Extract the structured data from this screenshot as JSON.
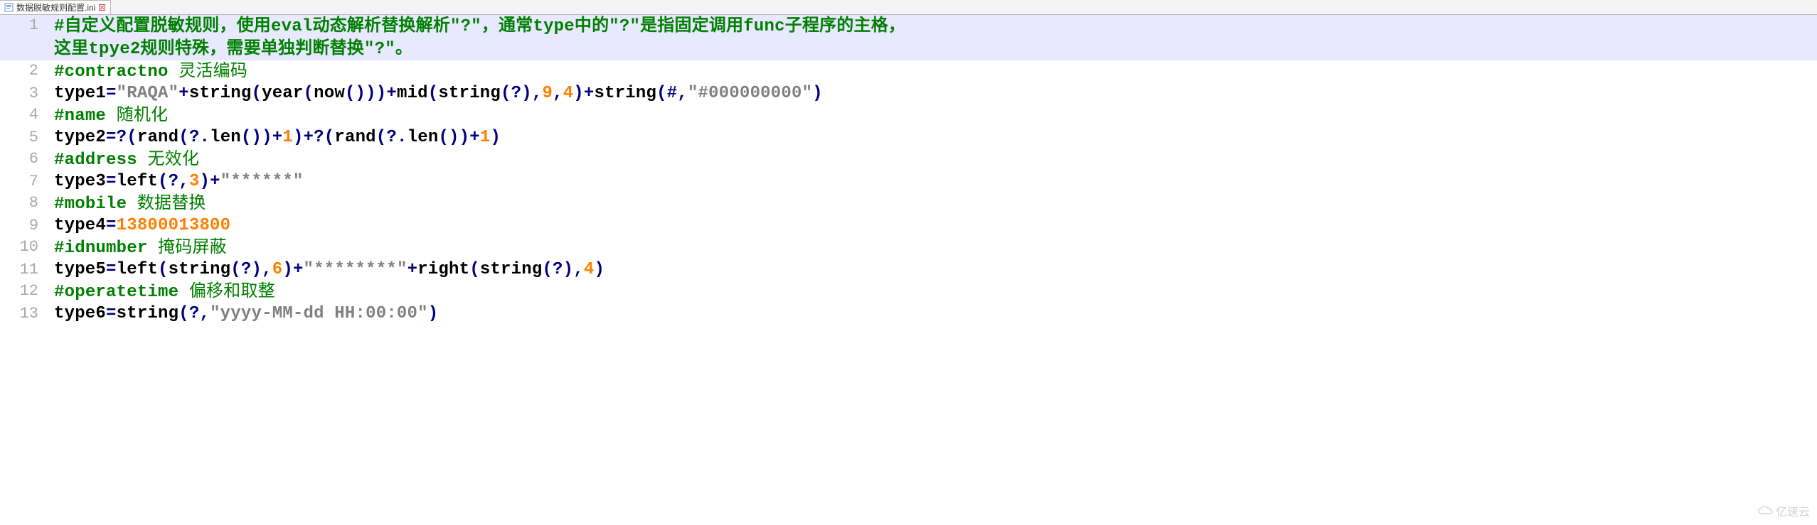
{
  "tab": {
    "filename": "数据脱敏规则配置.ini"
  },
  "watermark": "亿速云",
  "lines": [
    {
      "num": "1",
      "cursor": true,
      "tokens": [
        {
          "cls": "tok-comment-hash",
          "t": "#"
        },
        {
          "cls": "tok-comment-zh-b",
          "t": "自定义配置脱敏规则，使用"
        },
        {
          "cls": "tok-comment-en",
          "t": "eval"
        },
        {
          "cls": "tok-comment-zh-b",
          "t": "动态解析替换解析"
        },
        {
          "cls": "tok-comment-en",
          "t": "\"?\""
        },
        {
          "cls": "tok-comment-zh-b",
          "t": "，通常"
        },
        {
          "cls": "tok-comment-en",
          "t": "type"
        },
        {
          "cls": "tok-comment-zh-b",
          "t": "中的"
        },
        {
          "cls": "tok-comment-en",
          "t": "\"?\""
        },
        {
          "cls": "tok-comment-zh-b",
          "t": "是指固定调用"
        },
        {
          "cls": "tok-comment-en",
          "t": "func"
        },
        {
          "cls": "tok-comment-zh-b",
          "t": "子程序的主格，"
        }
      ]
    },
    {
      "num": "",
      "cursor": true,
      "tokens": [
        {
          "cls": "tok-comment-zh-b",
          "t": "这里"
        },
        {
          "cls": "tok-comment-en",
          "t": "tpye2"
        },
        {
          "cls": "tok-comment-zh-b",
          "t": "规则特殊，需要单独判断替换"
        },
        {
          "cls": "tok-comment-en",
          "t": "\"?\""
        },
        {
          "cls": "tok-comment-zh-b",
          "t": "。"
        }
      ]
    },
    {
      "num": "2",
      "tokens": [
        {
          "cls": "tok-comment-hash",
          "t": "#"
        },
        {
          "cls": "tok-comment-en",
          "t": "contractno "
        },
        {
          "cls": "tok-comment-zh",
          "t": "灵活编码"
        }
      ]
    },
    {
      "num": "3",
      "tokens": [
        {
          "cls": "tok-kw",
          "t": "type1"
        },
        {
          "cls": "tok-op",
          "t": "="
        },
        {
          "cls": "tok-str",
          "t": "\"RAQA\""
        },
        {
          "cls": "tok-op",
          "t": "+"
        },
        {
          "cls": "tok-func",
          "t": "string"
        },
        {
          "cls": "tok-punct",
          "t": "("
        },
        {
          "cls": "tok-func",
          "t": "year"
        },
        {
          "cls": "tok-punct",
          "t": "("
        },
        {
          "cls": "tok-func",
          "t": "now"
        },
        {
          "cls": "tok-punct",
          "t": "()))"
        },
        {
          "cls": "tok-op",
          "t": "+"
        },
        {
          "cls": "tok-func",
          "t": "mid"
        },
        {
          "cls": "tok-punct",
          "t": "("
        },
        {
          "cls": "tok-func",
          "t": "string"
        },
        {
          "cls": "tok-punct",
          "t": "("
        },
        {
          "cls": "tok-op",
          "t": "?"
        },
        {
          "cls": "tok-punct",
          "t": "),"
        },
        {
          "cls": "tok-num",
          "t": "9"
        },
        {
          "cls": "tok-punct",
          "t": ","
        },
        {
          "cls": "tok-num",
          "t": "4"
        },
        {
          "cls": "tok-punct",
          "t": ")"
        },
        {
          "cls": "tok-op",
          "t": "+"
        },
        {
          "cls": "tok-func",
          "t": "string"
        },
        {
          "cls": "tok-punct",
          "t": "("
        },
        {
          "cls": "tok-op",
          "t": "#"
        },
        {
          "cls": "tok-punct",
          "t": ","
        },
        {
          "cls": "tok-str",
          "t": "\"#000000000\""
        },
        {
          "cls": "tok-punct",
          "t": ")"
        }
      ]
    },
    {
      "num": "4",
      "tokens": [
        {
          "cls": "tok-comment-hash",
          "t": "#"
        },
        {
          "cls": "tok-comment-en",
          "t": "name "
        },
        {
          "cls": "tok-comment-zh",
          "t": "随机化"
        }
      ]
    },
    {
      "num": "5",
      "tokens": [
        {
          "cls": "tok-kw",
          "t": "type2"
        },
        {
          "cls": "tok-op",
          "t": "=?"
        },
        {
          "cls": "tok-punct",
          "t": "("
        },
        {
          "cls": "tok-func",
          "t": "rand"
        },
        {
          "cls": "tok-punct",
          "t": "("
        },
        {
          "cls": "tok-op",
          "t": "?."
        },
        {
          "cls": "tok-func",
          "t": "len"
        },
        {
          "cls": "tok-punct",
          "t": "())"
        },
        {
          "cls": "tok-op",
          "t": "+"
        },
        {
          "cls": "tok-num",
          "t": "1"
        },
        {
          "cls": "tok-punct",
          "t": ")"
        },
        {
          "cls": "tok-op",
          "t": "+?"
        },
        {
          "cls": "tok-punct",
          "t": "("
        },
        {
          "cls": "tok-func",
          "t": "rand"
        },
        {
          "cls": "tok-punct",
          "t": "("
        },
        {
          "cls": "tok-op",
          "t": "?."
        },
        {
          "cls": "tok-func",
          "t": "len"
        },
        {
          "cls": "tok-punct",
          "t": "())"
        },
        {
          "cls": "tok-op",
          "t": "+"
        },
        {
          "cls": "tok-num",
          "t": "1"
        },
        {
          "cls": "tok-punct",
          "t": ")"
        }
      ]
    },
    {
      "num": "6",
      "tokens": [
        {
          "cls": "tok-comment-hash",
          "t": "#"
        },
        {
          "cls": "tok-comment-en",
          "t": "address "
        },
        {
          "cls": "tok-comment-zh",
          "t": "无效化"
        }
      ]
    },
    {
      "num": "7",
      "tokens": [
        {
          "cls": "tok-kw",
          "t": "type3"
        },
        {
          "cls": "tok-op",
          "t": "="
        },
        {
          "cls": "tok-func",
          "t": "left"
        },
        {
          "cls": "tok-punct",
          "t": "("
        },
        {
          "cls": "tok-op",
          "t": "?"
        },
        {
          "cls": "tok-punct",
          "t": ","
        },
        {
          "cls": "tok-num",
          "t": "3"
        },
        {
          "cls": "tok-punct",
          "t": ")"
        },
        {
          "cls": "tok-op",
          "t": "+"
        },
        {
          "cls": "tok-str",
          "t": "\"******\""
        }
      ]
    },
    {
      "num": "8",
      "tokens": [
        {
          "cls": "tok-comment-hash",
          "t": "#"
        },
        {
          "cls": "tok-comment-en",
          "t": "mobile "
        },
        {
          "cls": "tok-comment-zh",
          "t": "数据替换"
        }
      ]
    },
    {
      "num": "9",
      "tokens": [
        {
          "cls": "tok-kw",
          "t": "type4"
        },
        {
          "cls": "tok-op",
          "t": "="
        },
        {
          "cls": "tok-num",
          "t": "13800013800"
        }
      ]
    },
    {
      "num": "10",
      "tokens": [
        {
          "cls": "tok-comment-hash",
          "t": "#"
        },
        {
          "cls": "tok-comment-en",
          "t": "idnumber "
        },
        {
          "cls": "tok-comment-zh",
          "t": "掩码屏蔽"
        }
      ]
    },
    {
      "num": "11",
      "tokens": [
        {
          "cls": "tok-kw",
          "t": "type5"
        },
        {
          "cls": "tok-op",
          "t": "="
        },
        {
          "cls": "tok-func",
          "t": "left"
        },
        {
          "cls": "tok-punct",
          "t": "("
        },
        {
          "cls": "tok-func",
          "t": "string"
        },
        {
          "cls": "tok-punct",
          "t": "("
        },
        {
          "cls": "tok-op",
          "t": "?"
        },
        {
          "cls": "tok-punct",
          "t": "),"
        },
        {
          "cls": "tok-num",
          "t": "6"
        },
        {
          "cls": "tok-punct",
          "t": ")"
        },
        {
          "cls": "tok-op",
          "t": "+"
        },
        {
          "cls": "tok-str",
          "t": "\"********\""
        },
        {
          "cls": "tok-op",
          "t": "+"
        },
        {
          "cls": "tok-func",
          "t": "right"
        },
        {
          "cls": "tok-punct",
          "t": "("
        },
        {
          "cls": "tok-func",
          "t": "string"
        },
        {
          "cls": "tok-punct",
          "t": "("
        },
        {
          "cls": "tok-op",
          "t": "?"
        },
        {
          "cls": "tok-punct",
          "t": "),"
        },
        {
          "cls": "tok-num",
          "t": "4"
        },
        {
          "cls": "tok-punct",
          "t": ")"
        }
      ]
    },
    {
      "num": "12",
      "tokens": [
        {
          "cls": "tok-comment-hash",
          "t": "#"
        },
        {
          "cls": "tok-comment-en",
          "t": "operatetime "
        },
        {
          "cls": "tok-comment-zh",
          "t": "偏移和取整"
        }
      ]
    },
    {
      "num": "13",
      "tokens": [
        {
          "cls": "tok-kw",
          "t": "type6"
        },
        {
          "cls": "tok-op",
          "t": "="
        },
        {
          "cls": "tok-func",
          "t": "string"
        },
        {
          "cls": "tok-punct",
          "t": "("
        },
        {
          "cls": "tok-op",
          "t": "?"
        },
        {
          "cls": "tok-punct",
          "t": ","
        },
        {
          "cls": "tok-str",
          "t": "\"yyyy-MM-dd HH:00:00\""
        },
        {
          "cls": "tok-punct",
          "t": ")"
        }
      ]
    }
  ]
}
